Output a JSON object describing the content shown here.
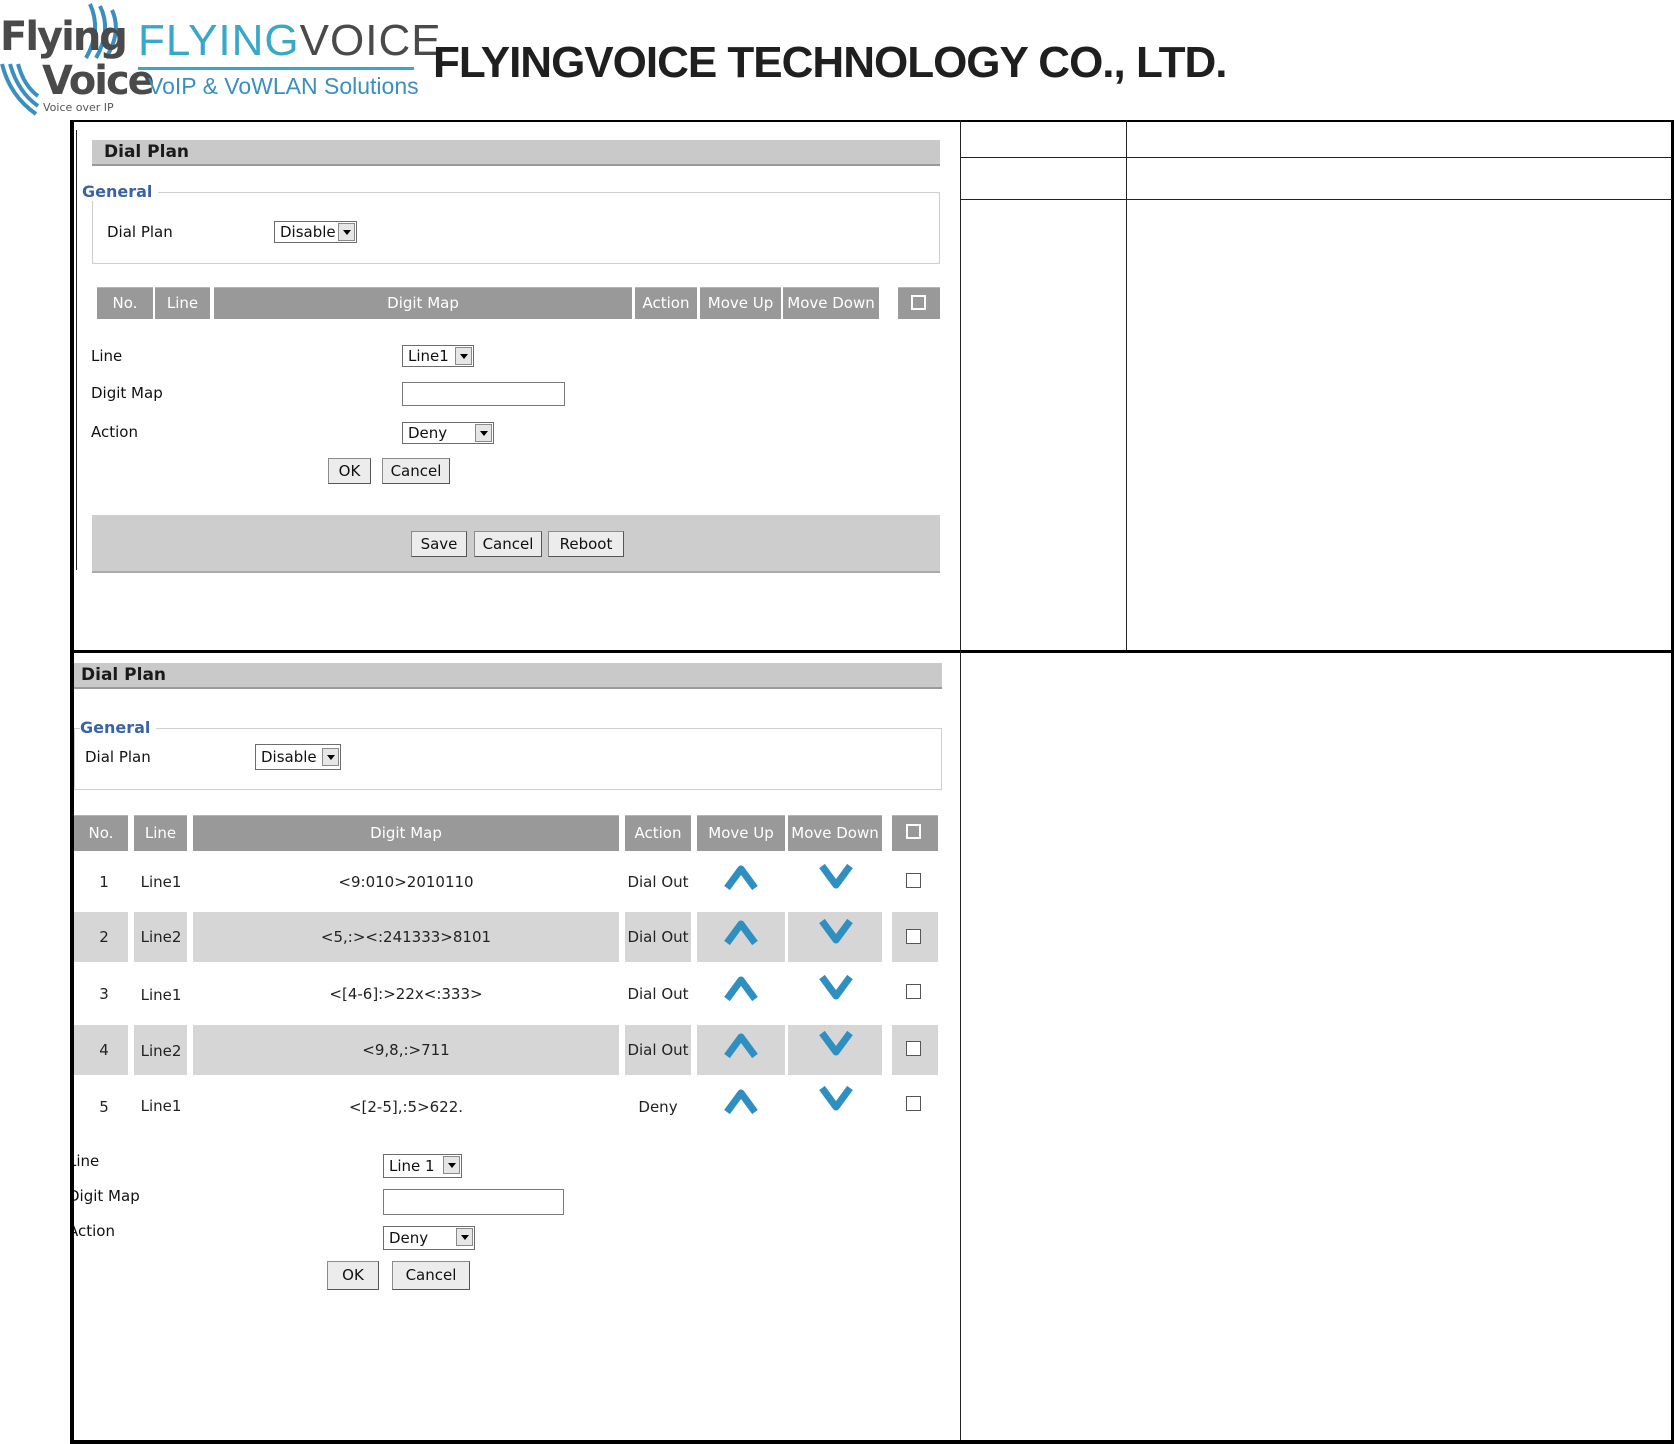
{
  "header": {
    "logo_flying": "Flying",
    "logo_voice": "Voice",
    "logo_voip": "Voice over IP",
    "brand_part1": "FLYING",
    "brand_part2": "VOICE",
    "brand_tagline": "VoIP & VoWLAN Solutions",
    "company": "FLYINGVOICE TECHNOLOGY CO., LTD."
  },
  "panel1": {
    "title": "Dial Plan",
    "general_legend": "General",
    "dial_plan_label": "Dial Plan",
    "dial_plan_value": "Disable",
    "columns": [
      "No.",
      "Line",
      "Digit Map",
      "Action",
      "Move Up",
      "Move Down"
    ],
    "form": {
      "line_label": "Line",
      "line_value": "Line1",
      "digit_map_label": "Digit Map",
      "digit_map_value": "",
      "action_label": "Action",
      "action_value": "Deny",
      "ok": "OK",
      "cancel": "Cancel"
    },
    "footer": {
      "save": "Save",
      "cancel": "Cancel",
      "reboot": "Reboot"
    }
  },
  "panel2": {
    "title": "Dial Plan",
    "general_legend": "General",
    "dial_plan_label": "Dial Plan",
    "dial_plan_value": "Disable",
    "columns": [
      "No.",
      "Line",
      "Digit Map",
      "Action",
      "Move Up",
      "Move Down"
    ],
    "rows": [
      {
        "no": "1",
        "line": "Line1",
        "digit_map": "<9:010>2010110",
        "action": "Dial Out"
      },
      {
        "no": "2",
        "line": "Line2",
        "digit_map": "<5,:><:241333>8101",
        "action": "Dial Out"
      },
      {
        "no": "3",
        "line": "Line1",
        "digit_map": "<[4-6]:>22x<:333>",
        "action": "Dial Out"
      },
      {
        "no": "4",
        "line": "Line2",
        "digit_map": "<9,8,:>711",
        "action": "Dial Out"
      },
      {
        "no": "5",
        "line": "Line1",
        "digit_map": "<[2-5],:5>622.",
        "action": "Deny"
      }
    ],
    "form": {
      "line_label": "Line",
      "line_value": "Line 1",
      "digit_map_label": "Digit Map",
      "digit_map_value": "",
      "action_label": "Action",
      "action_value": "Deny",
      "ok": "OK",
      "cancel": "Cancel"
    }
  },
  "colors": {
    "title_bar": "#c9c9c9",
    "column_header": "#999999",
    "legend_blue": "#3a63a6",
    "brand_cyan": "#38a8c8",
    "arrow_blue": "#2e8fc0"
  }
}
